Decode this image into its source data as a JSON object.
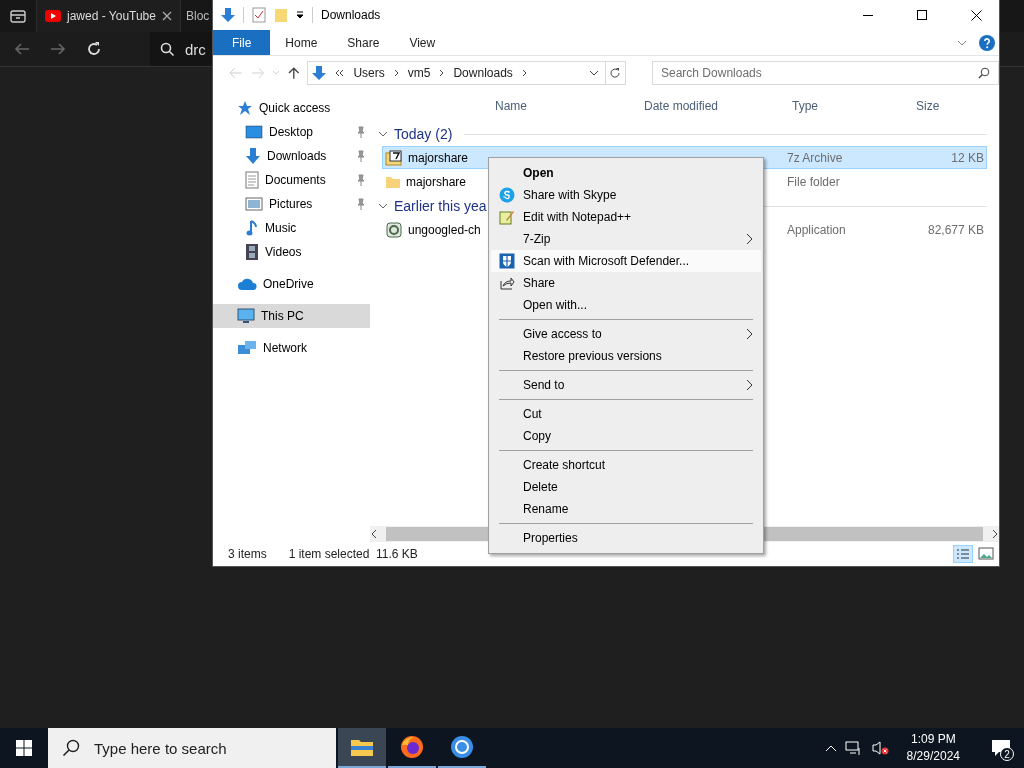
{
  "browser": {
    "tabs": [
      {
        "label": "jawed - YouTube",
        "kind": "youtube",
        "selected": true
      },
      {
        "label": "Bloc",
        "kind": "plain",
        "selected": false
      }
    ],
    "address": "drc"
  },
  "explorer": {
    "title": "Downloads",
    "ribbon_tabs": [
      {
        "label": "File",
        "selected": true
      },
      {
        "label": "Home",
        "selected": false
      },
      {
        "label": "Share",
        "selected": false
      },
      {
        "label": "View",
        "selected": false
      }
    ],
    "breadcrumb": [
      "Users",
      "vm5",
      "Downloads"
    ],
    "search": {
      "placeholder": "Search Downloads"
    },
    "columns": [
      "Name",
      "Date modified",
      "Type",
      "Size"
    ],
    "nav": [
      {
        "label": "Quick access",
        "kind": "star",
        "pinned": false,
        "selected": false,
        "children": [
          {
            "label": "Desktop",
            "kind": "desktop",
            "pinned": true,
            "selected": false
          },
          {
            "label": "Downloads",
            "kind": "download",
            "pinned": true,
            "selected": false
          },
          {
            "label": "Documents",
            "kind": "document",
            "pinned": true,
            "selected": false
          },
          {
            "label": "Pictures",
            "kind": "picture",
            "pinned": true,
            "selected": false
          },
          {
            "label": "Music",
            "kind": "music",
            "pinned": false,
            "selected": false
          },
          {
            "label": "Videos",
            "kind": "video",
            "pinned": false,
            "selected": false
          }
        ]
      },
      {
        "label": "OneDrive",
        "kind": "cloud",
        "pinned": false,
        "selected": false
      },
      {
        "label": "This PC",
        "kind": "pc",
        "pinned": false,
        "selected": true
      },
      {
        "label": "Network",
        "kind": "network",
        "pinned": false,
        "selected": false
      }
    ],
    "groups": [
      {
        "title": "Today (2)",
        "files": [
          {
            "name": "majorshare",
            "kind": "archive",
            "type": "7z Archive",
            "size": "12 KB",
            "selected": true
          },
          {
            "name": "majorshare",
            "kind": "folder",
            "type": "File folder",
            "selected": false
          }
        ]
      },
      {
        "title": "Earlier this yea",
        "files": [
          {
            "name": "ungoogled-ch",
            "kind": "app",
            "type": "Application",
            "size": "82,677 KB",
            "selected": false
          }
        ]
      }
    ],
    "status": {
      "count": "3 items",
      "selection": "1 item selected",
      "size": "11.6 KB"
    }
  },
  "context_menu": {
    "items": [
      {
        "kind": "item",
        "label": "Open",
        "bold": true,
        "submenu": false,
        "hovered": false
      },
      {
        "kind": "skype",
        "label": "Share with Skype",
        "submenu": false,
        "hovered": false
      },
      {
        "kind": "notepad",
        "label": "Edit with Notepad++",
        "submenu": false,
        "hovered": false
      },
      {
        "kind": "item",
        "label": "7-Zip",
        "submenu": true,
        "hovered": false
      },
      {
        "kind": "defender",
        "label": "Scan with Microsoft Defender...",
        "submenu": false,
        "hovered": true
      },
      {
        "kind": "share",
        "label": "Share",
        "submenu": false,
        "hovered": false
      },
      {
        "kind": "item",
        "label": "Open with...",
        "submenu": false,
        "hovered": false
      },
      {
        "kind": "separator"
      },
      {
        "kind": "item",
        "label": "Give access to",
        "submenu": true,
        "hovered": false
      },
      {
        "kind": "item",
        "label": "Restore previous versions",
        "submenu": false,
        "hovered": false
      },
      {
        "kind": "separator"
      },
      {
        "kind": "item",
        "label": "Send to",
        "submenu": true,
        "hovered": false
      },
      {
        "kind": "separator"
      },
      {
        "kind": "item",
        "label": "Cut",
        "submenu": false,
        "hovered": false
      },
      {
        "kind": "item",
        "label": "Copy",
        "submenu": false,
        "hovered": false
      },
      {
        "kind": "separator"
      },
      {
        "kind": "item",
        "label": "Create shortcut",
        "submenu": false,
        "hovered": false
      },
      {
        "kind": "item",
        "label": "Delete",
        "submenu": false,
        "hovered": false
      },
      {
        "kind": "item",
        "label": "Rename",
        "submenu": false,
        "hovered": false
      },
      {
        "kind": "separator"
      },
      {
        "kind": "item",
        "label": "Properties",
        "submenu": false,
        "hovered": false
      }
    ]
  },
  "taskbar": {
    "search": {
      "placeholder": "Type here to search"
    },
    "apps": [
      {
        "kind": "explorer",
        "selected": true,
        "running": true
      },
      {
        "kind": "firefox",
        "selected": false,
        "running": true
      },
      {
        "kind": "chromium",
        "selected": false,
        "running": true
      }
    ],
    "time": "1:09 PM",
    "date": "8/29/2024",
    "notifications": "2"
  }
}
